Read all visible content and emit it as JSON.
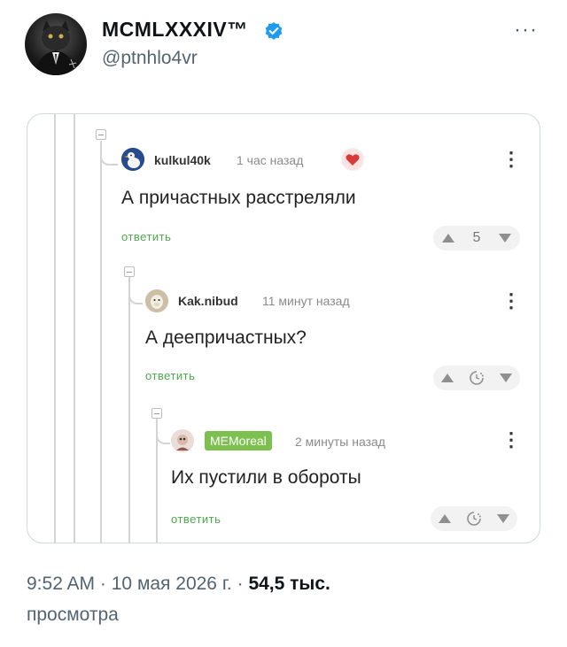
{
  "tweet": {
    "author_name": "MCMLXXXIV™",
    "handle": "@ptnhlo4vr",
    "more_icon": "more-horizontal-icon",
    "verified_color": "#1d9bf0",
    "time": "9:52 AM",
    "separator": "·",
    "date": "10 мая 2026 г.",
    "views_count": "54,5 тыс.",
    "views_label": "просмотра"
  },
  "comments": [
    {
      "user": "kulkul40k",
      "time": "1 час назад",
      "text": "А причастных расстреляли",
      "reply_label": "ответить",
      "rating": "5"
    },
    {
      "user": "Kak.nibud",
      "time": "11 минут назад",
      "text": "А деепричастных?",
      "reply_label": "ответить",
      "rating_icon": "pending-timer-icon"
    },
    {
      "user": "MEMoreal",
      "time": "2 минуты назад",
      "text": "Их пустили в обороты",
      "reply_label": "ответить",
      "rating_icon": "pending-timer-icon"
    }
  ],
  "colors": {
    "reply_green": "#4da84d",
    "badge_green": "#7dc04f",
    "thread_line": "#d4d4d4"
  }
}
